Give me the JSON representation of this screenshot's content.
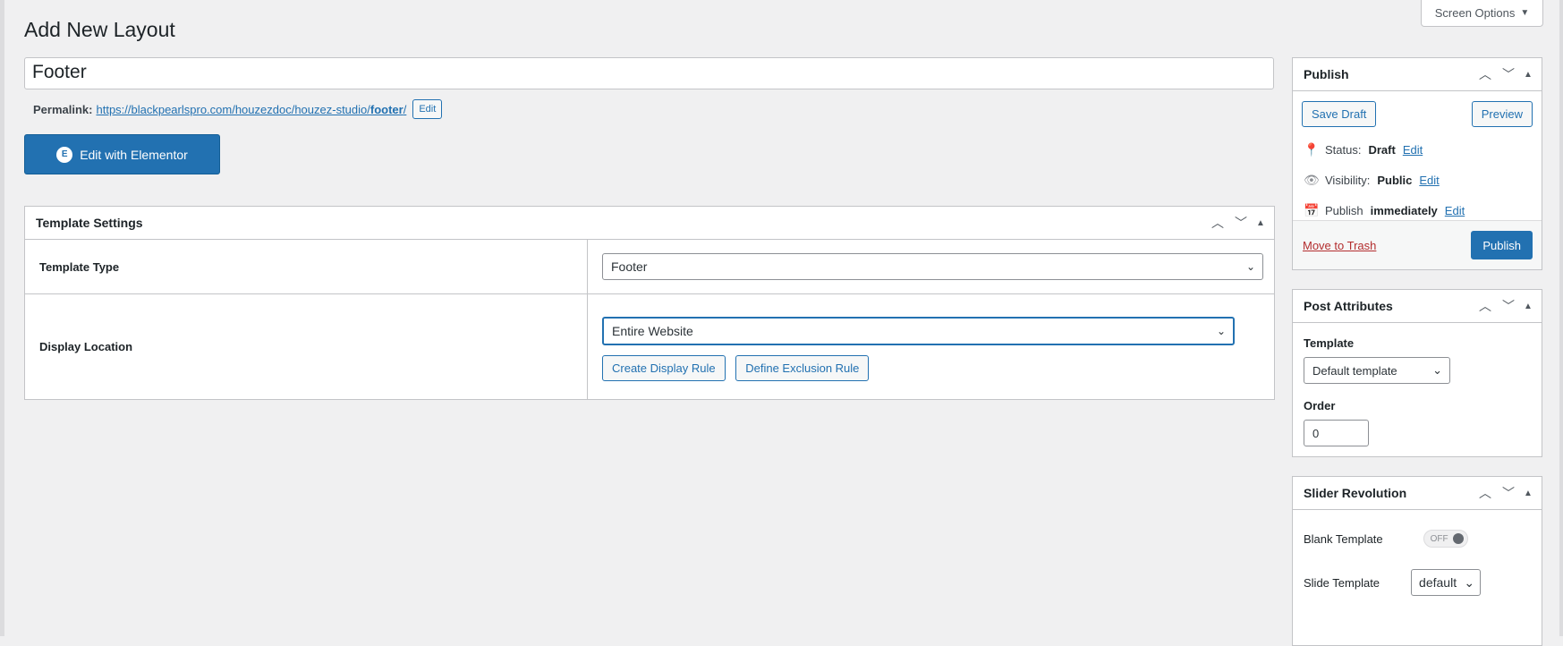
{
  "page": {
    "title": "Add New Layout",
    "screen_options": "Screen Options"
  },
  "post": {
    "title_value": "Footer",
    "permalink_label": "Permalink:",
    "permalink_base": "https://blackpearlspro.com/houzezdoc/houzez-studio/",
    "permalink_slug": "footer",
    "permalink_trail": "/",
    "permalink_edit": "Edit",
    "elementor_button": "Edit with Elementor"
  },
  "template_settings": {
    "title": "Template Settings",
    "type_label": "Template Type",
    "type_value": "Footer",
    "location_label": "Display Location",
    "location_value": "Entire Website",
    "create_rule": "Create Display Rule",
    "exclusion_rule": "Define Exclusion Rule"
  },
  "publish": {
    "title": "Publish",
    "save_draft": "Save Draft",
    "preview": "Preview",
    "status_label": "Status:",
    "status_value": "Draft",
    "visibility_label": "Visibility:",
    "visibility_value": "Public",
    "schedule_label": "Publish",
    "schedule_value": "immediately",
    "edit": "Edit",
    "trash": "Move to Trash",
    "publish_button": "Publish"
  },
  "post_attributes": {
    "title": "Post Attributes",
    "template_label": "Template",
    "template_value": "Default template",
    "order_label": "Order",
    "order_value": "0"
  },
  "slider_revolution": {
    "title": "Slider Revolution",
    "blank_template_label": "Blank Template",
    "toggle_state": "OFF",
    "slide_template_label": "Slide Template",
    "slide_template_value": "default"
  },
  "colors": {
    "accent": "#2271b1",
    "background": "#f0f0f1",
    "danger": "#b32d2e"
  }
}
